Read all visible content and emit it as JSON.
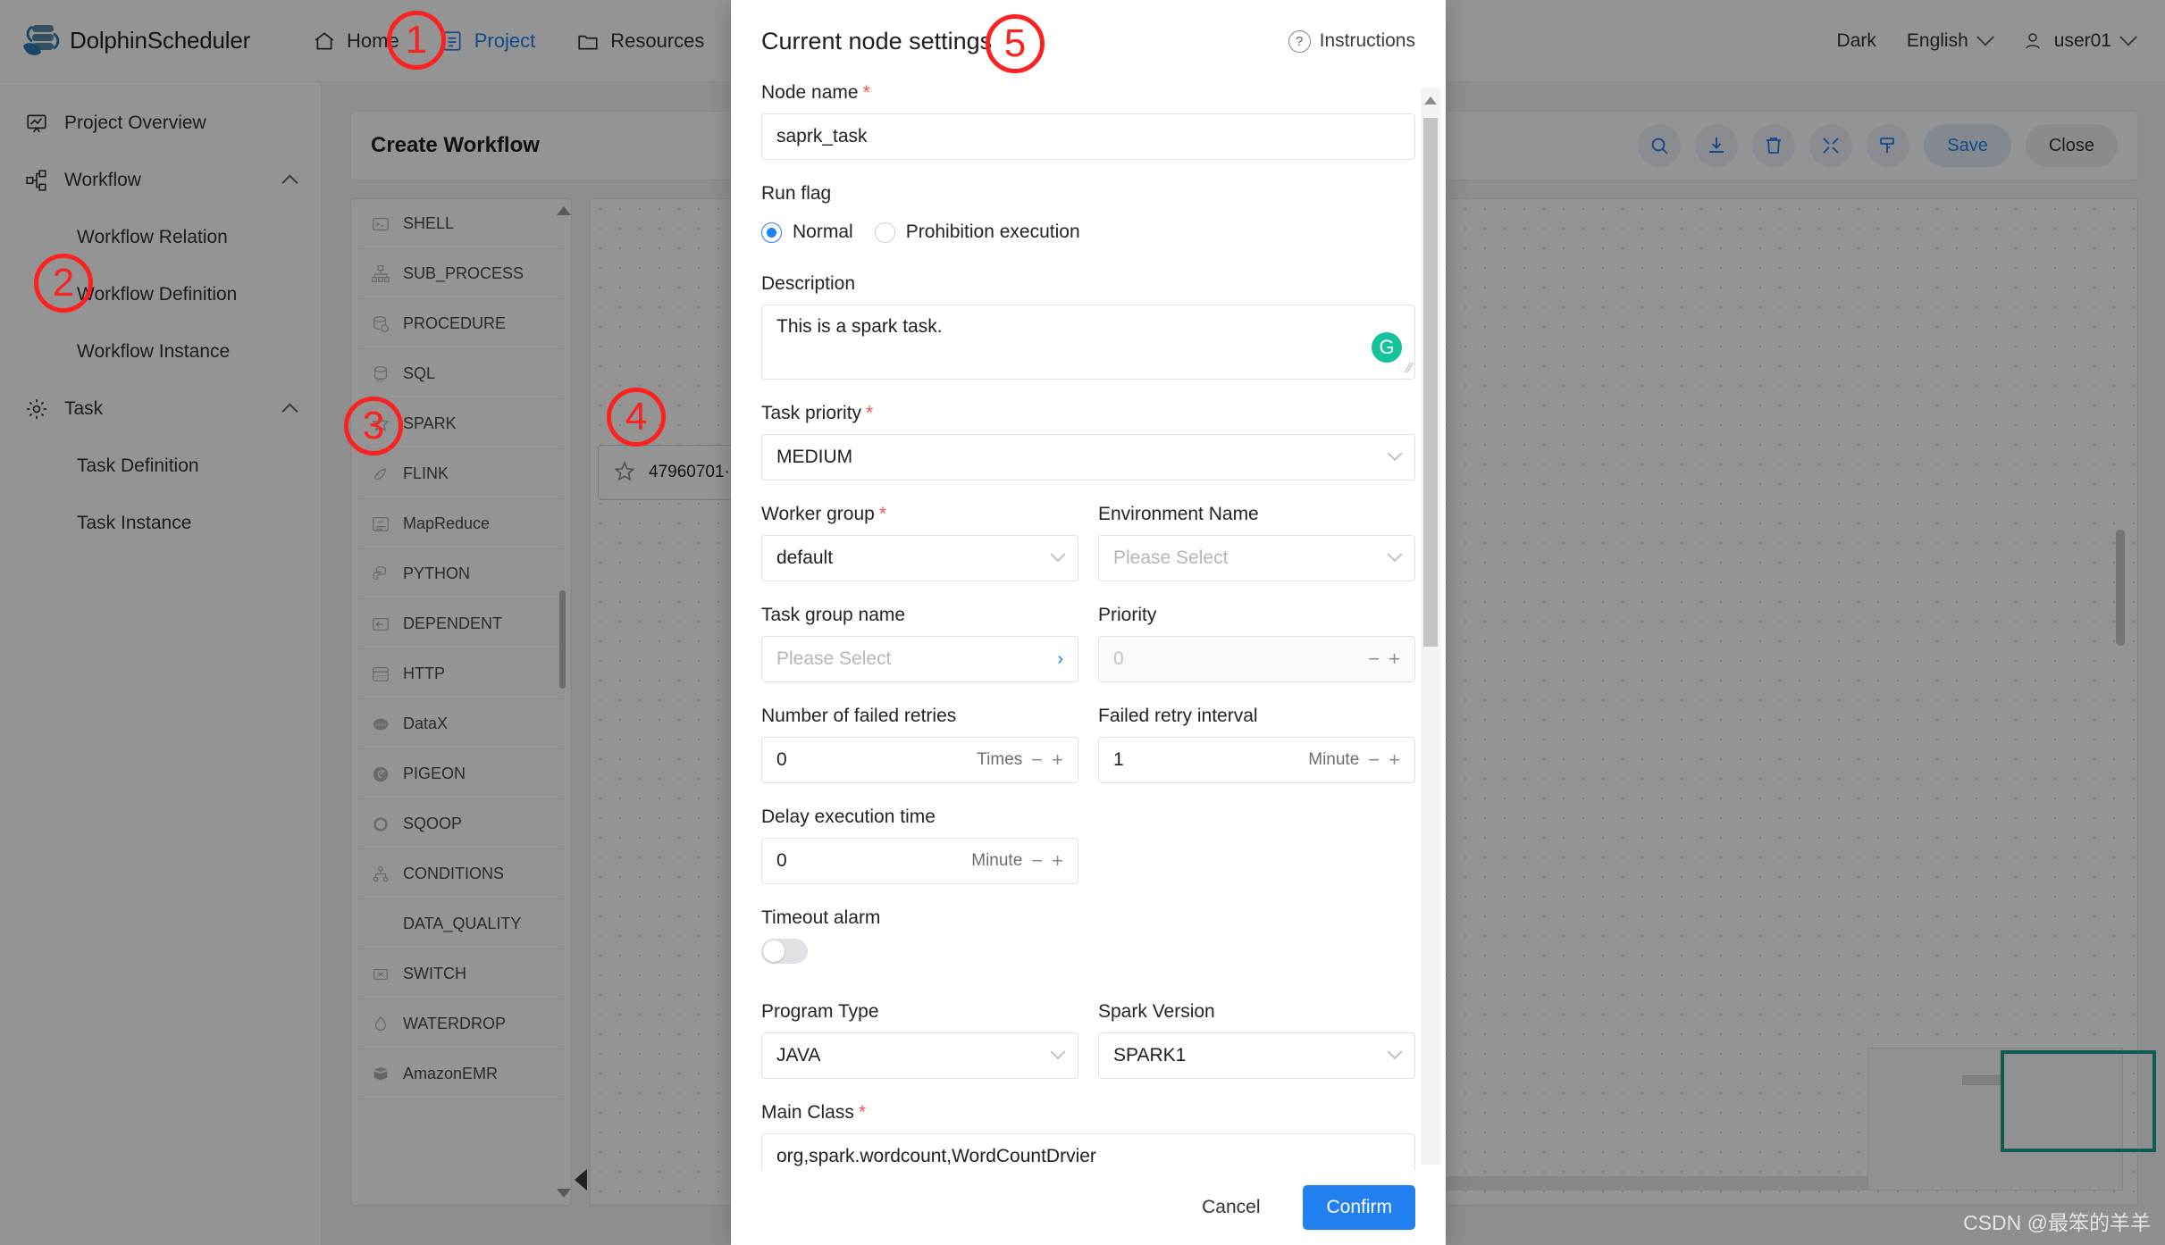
{
  "topbar": {
    "brand": "DolphinScheduler",
    "nav": [
      {
        "label": "Home",
        "icon": "home-icon",
        "active": false
      },
      {
        "label": "Project",
        "icon": "project-icon",
        "active": true
      },
      {
        "label": "Resources",
        "icon": "resources-icon",
        "active": false
      }
    ],
    "theme": "Dark",
    "language": "English",
    "user": "user01"
  },
  "sidebar": {
    "items": [
      {
        "label": "Project Overview",
        "icon": "dashboard-icon",
        "type": "row"
      },
      {
        "label": "Workflow",
        "icon": "workflow-icon",
        "type": "group"
      },
      {
        "label": "Workflow Relation",
        "type": "sub"
      },
      {
        "label": "Workflow Definition",
        "type": "sub"
      },
      {
        "label": "Workflow Instance",
        "type": "sub"
      },
      {
        "label": "Task",
        "icon": "gear-icon",
        "type": "group"
      },
      {
        "label": "Task Definition",
        "type": "sub"
      },
      {
        "label": "Task Instance",
        "type": "sub"
      }
    ]
  },
  "workflow": {
    "title": "Create Workflow",
    "toolbar": {
      "icons": [
        "search-icon",
        "download-icon",
        "trash-icon",
        "fullscreen-icon",
        "format-icon"
      ],
      "save_label": "Save",
      "close_label": "Close"
    },
    "task_types": [
      {
        "label": "SHELL",
        "icon": "shell-icon"
      },
      {
        "label": "SUB_PROCESS",
        "icon": "subprocess-icon"
      },
      {
        "label": "PROCEDURE",
        "icon": "procedure-icon"
      },
      {
        "label": "SQL",
        "icon": "sql-icon"
      },
      {
        "label": "SPARK",
        "icon": "spark-icon"
      },
      {
        "label": "FLINK",
        "icon": "flink-icon"
      },
      {
        "label": "MapReduce",
        "icon": "mapreduce-icon"
      },
      {
        "label": "PYTHON",
        "icon": "python-icon"
      },
      {
        "label": "DEPENDENT",
        "icon": "dependent-icon"
      },
      {
        "label": "HTTP",
        "icon": "http-icon"
      },
      {
        "label": "DataX",
        "icon": "datax-icon"
      },
      {
        "label": "PIGEON",
        "icon": "pigeon-icon"
      },
      {
        "label": "SQOOP",
        "icon": "sqoop-icon"
      },
      {
        "label": "CONDITIONS",
        "icon": "conditions-icon"
      },
      {
        "label": "DATA_QUALITY",
        "icon": ""
      },
      {
        "label": "SWITCH",
        "icon": "switch-icon"
      },
      {
        "label": "WATERDROP",
        "icon": "waterdrop-icon"
      },
      {
        "label": "AmazonEMR",
        "icon": "amazonemr-icon"
      }
    ],
    "canvas_node": {
      "label": "47960701·",
      "icon": "spark-icon"
    }
  },
  "modal": {
    "title": "Current node settings",
    "instructions": "Instructions",
    "node_name": {
      "label": "Node name",
      "required": true,
      "value": "saprk_task"
    },
    "run_flag": {
      "label": "Run flag",
      "options": [
        {
          "label": "Normal",
          "selected": true
        },
        {
          "label": "Prohibition execution",
          "selected": false
        }
      ]
    },
    "description": {
      "label": "Description",
      "value": "This is a spark task."
    },
    "task_priority": {
      "label": "Task priority",
      "required": true,
      "value": "MEDIUM"
    },
    "worker_group": {
      "label": "Worker group",
      "required": true,
      "value": "default"
    },
    "environment_name": {
      "label": "Environment Name",
      "placeholder": "Please Select",
      "value": ""
    },
    "task_group_name": {
      "label": "Task group name",
      "placeholder": "Please Select",
      "value": ""
    },
    "priority": {
      "label": "Priority",
      "value": "0",
      "disabled": true
    },
    "failed_retries": {
      "label": "Number of failed retries",
      "value": "0",
      "unit": "Times"
    },
    "failed_retry_interval": {
      "label": "Failed retry interval",
      "value": "1",
      "unit": "Minute"
    },
    "delay_execution_time": {
      "label": "Delay execution time",
      "value": "0",
      "unit": "Minute"
    },
    "timeout_alarm": {
      "label": "Timeout alarm",
      "on": false
    },
    "program_type": {
      "label": "Program Type",
      "value": "JAVA"
    },
    "spark_version": {
      "label": "Spark Version",
      "value": "SPARK1"
    },
    "main_class": {
      "label": "Main Class",
      "required": true,
      "value": "org,spark.wordcount,WordCountDrvier"
    },
    "cancel_label": "Cancel",
    "confirm_label": "Confirm"
  },
  "annotations": [
    {
      "num": "1"
    },
    {
      "num": "2"
    },
    {
      "num": "3"
    },
    {
      "num": "4"
    },
    {
      "num": "5"
    }
  ],
  "watermark": "CSDN @最笨的羊羊",
  "colors": {
    "accent": "#2080f0",
    "required": "#f5534f",
    "annotation": "#fb2222",
    "grammarly": "#15c39a",
    "minimap": "#1f9e8f"
  }
}
